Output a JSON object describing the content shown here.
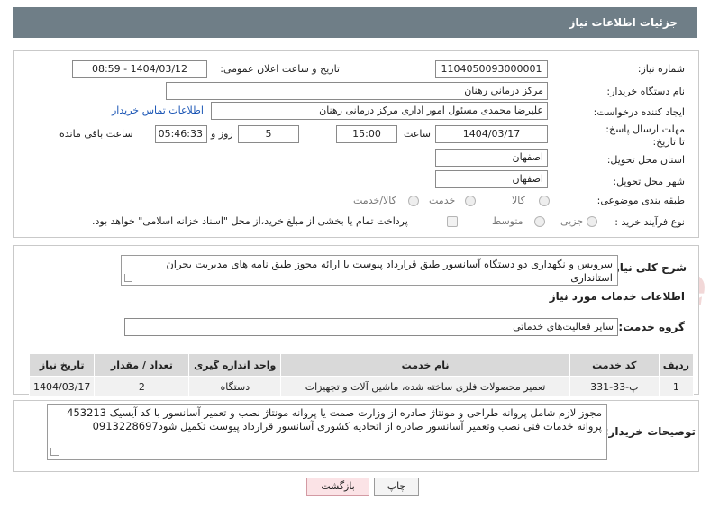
{
  "header": {
    "title": "جزئیات اطلاعات نیاز"
  },
  "form": {
    "need_number_label": "شماره نیاز:",
    "need_number": "1104050093000001",
    "announce_label": "تاریخ و ساعت اعلان عمومی:",
    "announce_value": "1404/03/12 - 08:59",
    "buyer_org_label": "نام دستگاه خریدار:",
    "buyer_org": "مرکز درمانی رهنان",
    "creator_label": "ایجاد کننده درخواست:",
    "creator": "علیرضا محمدی مسئول امور اداری مرکز درمانی رهنان",
    "contact_link": "اطلاعات تماس خریدار",
    "deadline_label": "مهلت ارسال پاسخ: تا تاریخ:",
    "deadline_date": "1404/03/17",
    "time_label": "ساعت",
    "deadline_time": "15:00",
    "days_value": "5",
    "days_label": "روز و",
    "remaining_time": "05:46:33",
    "remaining_label": "ساعت باقی مانده",
    "province_label": "استان محل تحویل:",
    "province": "اصفهان",
    "city_label": "شهر محل تحویل:",
    "city": "اصفهان",
    "category_label": "طبقه بندی موضوعی:",
    "category_options": [
      "کالا",
      "خدمت",
      "کالا/خدمت"
    ],
    "purchase_type_label": "نوع فرآیند خرید :",
    "purchase_options": [
      "جزیی",
      "متوسط"
    ],
    "payment_note": "پرداخت تمام یا بخشی از مبلغ خرید،از محل \"اسناد خزانه اسلامی\" خواهد بود."
  },
  "summary": {
    "label": "شرح کلی نیاز:",
    "text": "سرویس و نگهداری دو دستگاه آسانسور طبق قرارداد پیوست با ارائه مجوز طبق نامه های مدیریت بحران استانداری"
  },
  "services": {
    "section_title": "اطلاعات خدمات مورد نیاز",
    "group_label": "گروه خدمت:",
    "group_value": "سایر فعالیت‌های خدماتی",
    "columns": [
      "ردیف",
      "کد خدمت",
      "نام خدمت",
      "واحد اندازه گیری",
      "تعداد / مقدار",
      "تاریخ نیاز"
    ],
    "rows": [
      [
        "1",
        "پ-33-331",
        "تعمیر محصولات فلزی ساخته شده، ماشین آلات و تجهیزات",
        "دستگاه",
        "2",
        "1404/03/17"
      ]
    ]
  },
  "buyer_notes": {
    "label": "توضیحات خریدار:",
    "text": "مجوز لازم شامل پروانه طراحی و مونتاژ صادره از وزارت صمت یا پروانه مونتاژ نصب و تعمیر آسانسور با کد آیسیک 453213 پروانه خدمات فنی نصب وتعمیر آسانسور صادره از اتحادیه کشوری آسانسور قرارداد پیوست تکمیل شود0913228697"
  },
  "buttons": {
    "print": "چاپ",
    "back": "بازگشت"
  },
  "watermark": {
    "text": "AriaTender.neT"
  },
  "colors": {
    "header_bg": "#6f7e87",
    "link": "#1a55b5",
    "back_btn_bg": "#fbe3e6",
    "watermark": "#e9b8b8"
  }
}
